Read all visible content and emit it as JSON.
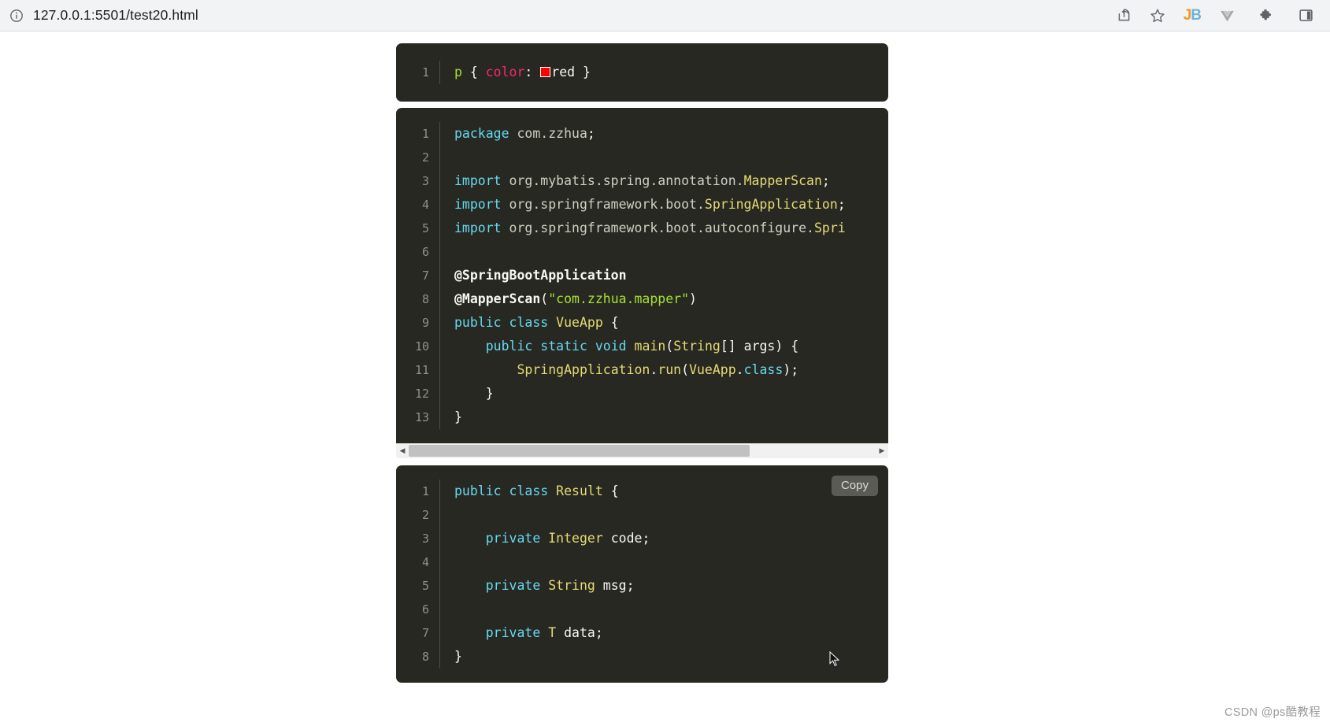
{
  "browser": {
    "url": "127.0.0.1:5501/test20.html",
    "info_icon": "info-circle-icon",
    "share_icon": "share-icon",
    "bookmark_icon": "star-icon",
    "extensions": [
      {
        "name": "jetbrains-toolbox-icon",
        "label_j": "J",
        "label_b": "B"
      },
      {
        "name": "vue-devtools-icon",
        "glyph": "▼"
      },
      {
        "name": "extensions-puzzle-icon",
        "glyph": "🧩"
      },
      {
        "name": "side-panel-icon",
        "glyph": "▣"
      }
    ]
  },
  "code_blocks": [
    {
      "id": "css-block",
      "language": "css",
      "has_copy_button": false,
      "has_hscrollbar": false,
      "lines": [
        {
          "n": "1",
          "tokens": [
            {
              "t": "p",
              "c": "t-sel"
            },
            {
              "t": " { ",
              "c": "t-punc"
            },
            {
              "t": "color",
              "c": "t-prop"
            },
            {
              "t": ": ",
              "c": "t-punc"
            },
            {
              "t": "@swatch",
              "c": "swatch"
            },
            {
              "t": "red",
              "c": "t-white"
            },
            {
              "t": " }",
              "c": "t-punc"
            }
          ]
        }
      ]
    },
    {
      "id": "java-vueapp-block",
      "language": "java",
      "has_copy_button": false,
      "has_hscrollbar": true,
      "lines": [
        {
          "n": "1",
          "tokens": [
            {
              "t": "package",
              "c": "t-key"
            },
            {
              "t": " com.zzhua",
              "c": "t-plain"
            },
            {
              "t": ";",
              "c": "t-white"
            }
          ]
        },
        {
          "n": "2",
          "tokens": [
            {
              "t": "",
              "c": "t-plain"
            }
          ]
        },
        {
          "n": "3",
          "tokens": [
            {
              "t": "import",
              "c": "t-key"
            },
            {
              "t": " org.mybatis.spring.annotation.",
              "c": "t-plain"
            },
            {
              "t": "MapperScan",
              "c": "t-type"
            },
            {
              "t": ";",
              "c": "t-white"
            }
          ]
        },
        {
          "n": "4",
          "tokens": [
            {
              "t": "import",
              "c": "t-key"
            },
            {
              "t": " org.springframework.boot.",
              "c": "t-plain"
            },
            {
              "t": "SpringApplication",
              "c": "t-type"
            },
            {
              "t": ";",
              "c": "t-white"
            }
          ]
        },
        {
          "n": "5",
          "tokens": [
            {
              "t": "import",
              "c": "t-key"
            },
            {
              "t": " org.springframework.boot.autoconfigure.",
              "c": "t-plain"
            },
            {
              "t": "Spri",
              "c": "t-type"
            }
          ]
        },
        {
          "n": "6",
          "tokens": [
            {
              "t": "",
              "c": "t-plain"
            }
          ]
        },
        {
          "n": "7",
          "tokens": [
            {
              "t": "@SpringBootApplication",
              "c": "t-ann"
            }
          ]
        },
        {
          "n": "8",
          "tokens": [
            {
              "t": "@MapperScan",
              "c": "t-ann"
            },
            {
              "t": "(",
              "c": "t-white"
            },
            {
              "t": "\"com.zzhua.mapper\"",
              "c": "t-str"
            },
            {
              "t": ")",
              "c": "t-white"
            }
          ]
        },
        {
          "n": "9",
          "tokens": [
            {
              "t": "public",
              "c": "t-key"
            },
            {
              "t": " ",
              "c": "t-white"
            },
            {
              "t": "class",
              "c": "t-key"
            },
            {
              "t": " ",
              "c": "t-white"
            },
            {
              "t": "VueApp",
              "c": "t-type"
            },
            {
              "t": " {",
              "c": "t-white"
            }
          ]
        },
        {
          "n": "10",
          "tokens": [
            {
              "t": "    ",
              "c": "t-white"
            },
            {
              "t": "public",
              "c": "t-key"
            },
            {
              "t": " ",
              "c": "t-white"
            },
            {
              "t": "static",
              "c": "t-key"
            },
            {
              "t": " ",
              "c": "t-white"
            },
            {
              "t": "void",
              "c": "t-key"
            },
            {
              "t": " ",
              "c": "t-white"
            },
            {
              "t": "main",
              "c": "t-type"
            },
            {
              "t": "(",
              "c": "t-white"
            },
            {
              "t": "String",
              "c": "t-type"
            },
            {
              "t": "[] args) {",
              "c": "t-white"
            }
          ]
        },
        {
          "n": "11",
          "tokens": [
            {
              "t": "        ",
              "c": "t-white"
            },
            {
              "t": "SpringApplication",
              "c": "t-type"
            },
            {
              "t": ".",
              "c": "t-white"
            },
            {
              "t": "run",
              "c": "t-type"
            },
            {
              "t": "(",
              "c": "t-white"
            },
            {
              "t": "VueApp",
              "c": "t-type"
            },
            {
              "t": ".",
              "c": "t-white"
            },
            {
              "t": "class",
              "c": "t-key"
            },
            {
              "t": ");",
              "c": "t-white"
            }
          ]
        },
        {
          "n": "12",
          "tokens": [
            {
              "t": "    }",
              "c": "t-white"
            }
          ]
        },
        {
          "n": "13",
          "tokens": [
            {
              "t": "}",
              "c": "t-white"
            }
          ]
        }
      ]
    },
    {
      "id": "java-result-block",
      "language": "java",
      "has_copy_button": true,
      "copy_label": "Copy",
      "has_hscrollbar": false,
      "lines": [
        {
          "n": "1",
          "tokens": [
            {
              "t": "public",
              "c": "t-key"
            },
            {
              "t": " ",
              "c": "t-white"
            },
            {
              "t": "class",
              "c": "t-key"
            },
            {
              "t": " ",
              "c": "t-white"
            },
            {
              "t": "Result",
              "c": "t-type"
            },
            {
              "t": " {",
              "c": "t-white"
            }
          ]
        },
        {
          "n": "2",
          "tokens": [
            {
              "t": "",
              "c": "t-plain"
            }
          ]
        },
        {
          "n": "3",
          "tokens": [
            {
              "t": "    ",
              "c": "t-white"
            },
            {
              "t": "private",
              "c": "t-key"
            },
            {
              "t": " ",
              "c": "t-white"
            },
            {
              "t": "Integer",
              "c": "t-type"
            },
            {
              "t": " code;",
              "c": "t-white"
            }
          ]
        },
        {
          "n": "4",
          "tokens": [
            {
              "t": "",
              "c": "t-plain"
            }
          ]
        },
        {
          "n": "5",
          "tokens": [
            {
              "t": "    ",
              "c": "t-white"
            },
            {
              "t": "private",
              "c": "t-key"
            },
            {
              "t": " ",
              "c": "t-white"
            },
            {
              "t": "String",
              "c": "t-type"
            },
            {
              "t": " msg;",
              "c": "t-white"
            }
          ]
        },
        {
          "n": "6",
          "tokens": [
            {
              "t": "",
              "c": "t-plain"
            }
          ]
        },
        {
          "n": "7",
          "tokens": [
            {
              "t": "    ",
              "c": "t-white"
            },
            {
              "t": "private",
              "c": "t-key"
            },
            {
              "t": " ",
              "c": "t-white"
            },
            {
              "t": "T",
              "c": "t-type"
            },
            {
              "t": " data;",
              "c": "t-white"
            }
          ]
        },
        {
          "n": "8",
          "tokens": [
            {
              "t": "}",
              "c": "t-white"
            }
          ]
        }
      ]
    }
  ],
  "watermark": "CSDN @ps酷教程"
}
